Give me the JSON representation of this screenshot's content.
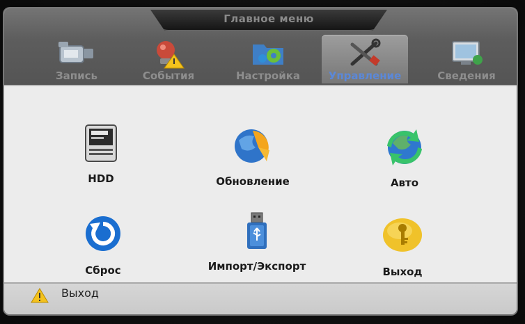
{
  "header": {
    "title": "Главное меню"
  },
  "tabs": [
    {
      "label": "Запись",
      "icon": "camcorder-icon",
      "active": false
    },
    {
      "label": "События",
      "icon": "alarm-bell-icon",
      "active": false
    },
    {
      "label": "Настройка",
      "icon": "settings-folder-icon",
      "active": false
    },
    {
      "label": "Управление",
      "icon": "tools-icon",
      "active": true
    },
    {
      "label": "Сведения",
      "icon": "info-monitor-icon",
      "active": false
    }
  ],
  "items": [
    {
      "label": "HDD",
      "icon": "hard-drive-icon"
    },
    {
      "label": "Обновление",
      "icon": "update-globe-icon"
    },
    {
      "label": "Авто",
      "icon": "auto-maintain-icon"
    },
    {
      "label": "Сброс",
      "icon": "reset-icon"
    },
    {
      "label": "Импорт/Экспорт",
      "icon": "usb-drive-icon"
    },
    {
      "label": "Выход",
      "icon": "logout-key-icon"
    }
  ],
  "status": {
    "text": "Выход",
    "icon": "warning-icon"
  },
  "colors": {
    "active_tab_label": "#5b88d8",
    "header_bg": "#5d5d5d",
    "content_bg": "#ececec"
  }
}
